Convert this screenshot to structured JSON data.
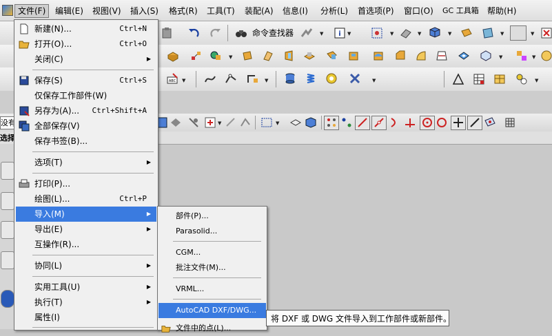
{
  "menubar": {
    "items": [
      "文件(F)",
      "编辑(E)",
      "视图(V)",
      "插入(S)",
      "格式(R)",
      "工具(T)",
      "装配(A)",
      "信息(I)",
      "分析(L)",
      "首选项(P)",
      "窗口(O)",
      "GC 工具箱",
      "帮助(H)"
    ],
    "active_index": 0
  },
  "toolbar": {
    "command_finder_label": "命令查找器"
  },
  "selection_bar": {
    "filter_value": "没有",
    "tab_label": "选择"
  },
  "file_menu": {
    "items": [
      {
        "label": "新建(N)...",
        "shortcut": "Ctrl+N",
        "icon": "new-file-icon"
      },
      {
        "label": "打开(O)...",
        "shortcut": "Ctrl+O",
        "icon": "open-folder-icon"
      },
      {
        "label": "关闭(C)",
        "submenu": true
      },
      {
        "label": "保存(S)",
        "shortcut": "Ctrl+S",
        "icon": "save-icon"
      },
      {
        "label": "仅保存工作部件(W)"
      },
      {
        "label": "另存为(A)...",
        "shortcut": "Ctrl+Shift+A",
        "icon": "save-as-icon"
      },
      {
        "label": "全部保存(V)",
        "icon": "save-all-icon"
      },
      {
        "label": "保存书签(B)..."
      },
      {
        "label": "选项(T)",
        "submenu": true
      },
      {
        "label": "打印(P)...",
        "icon": "print-icon"
      },
      {
        "label": "绘图(L)...",
        "shortcut": "Ctrl+P"
      },
      {
        "label": "导入(M)",
        "submenu": true,
        "highlighted": true
      },
      {
        "label": "导出(E)",
        "submenu": true
      },
      {
        "label": "互操作(R)..."
      },
      {
        "label": "协同(L)",
        "submenu": true
      },
      {
        "label": "实用工具(U)",
        "submenu": true
      },
      {
        "label": "执行(T)",
        "submenu": true
      },
      {
        "label": "属性(I)"
      }
    ]
  },
  "import_submenu": {
    "items": [
      {
        "label": "部件(P)..."
      },
      {
        "label": "Parasolid..."
      },
      {
        "label": "CGM..."
      },
      {
        "label": "批注文件(M)..."
      },
      {
        "label": "VRML..."
      },
      {
        "label": "AutoCAD DXF/DWG...",
        "highlighted": true
      },
      {
        "label": "文件中的点(L)..."
      }
    ]
  },
  "tooltip": {
    "text": "将 DXF 或 DWG 文件导入到工作部件或新部件。"
  },
  "colors": {
    "highlight": "#3a7be0",
    "menu_bg": "#f0f0f0",
    "canvas_bg": "#c9c9c9"
  }
}
